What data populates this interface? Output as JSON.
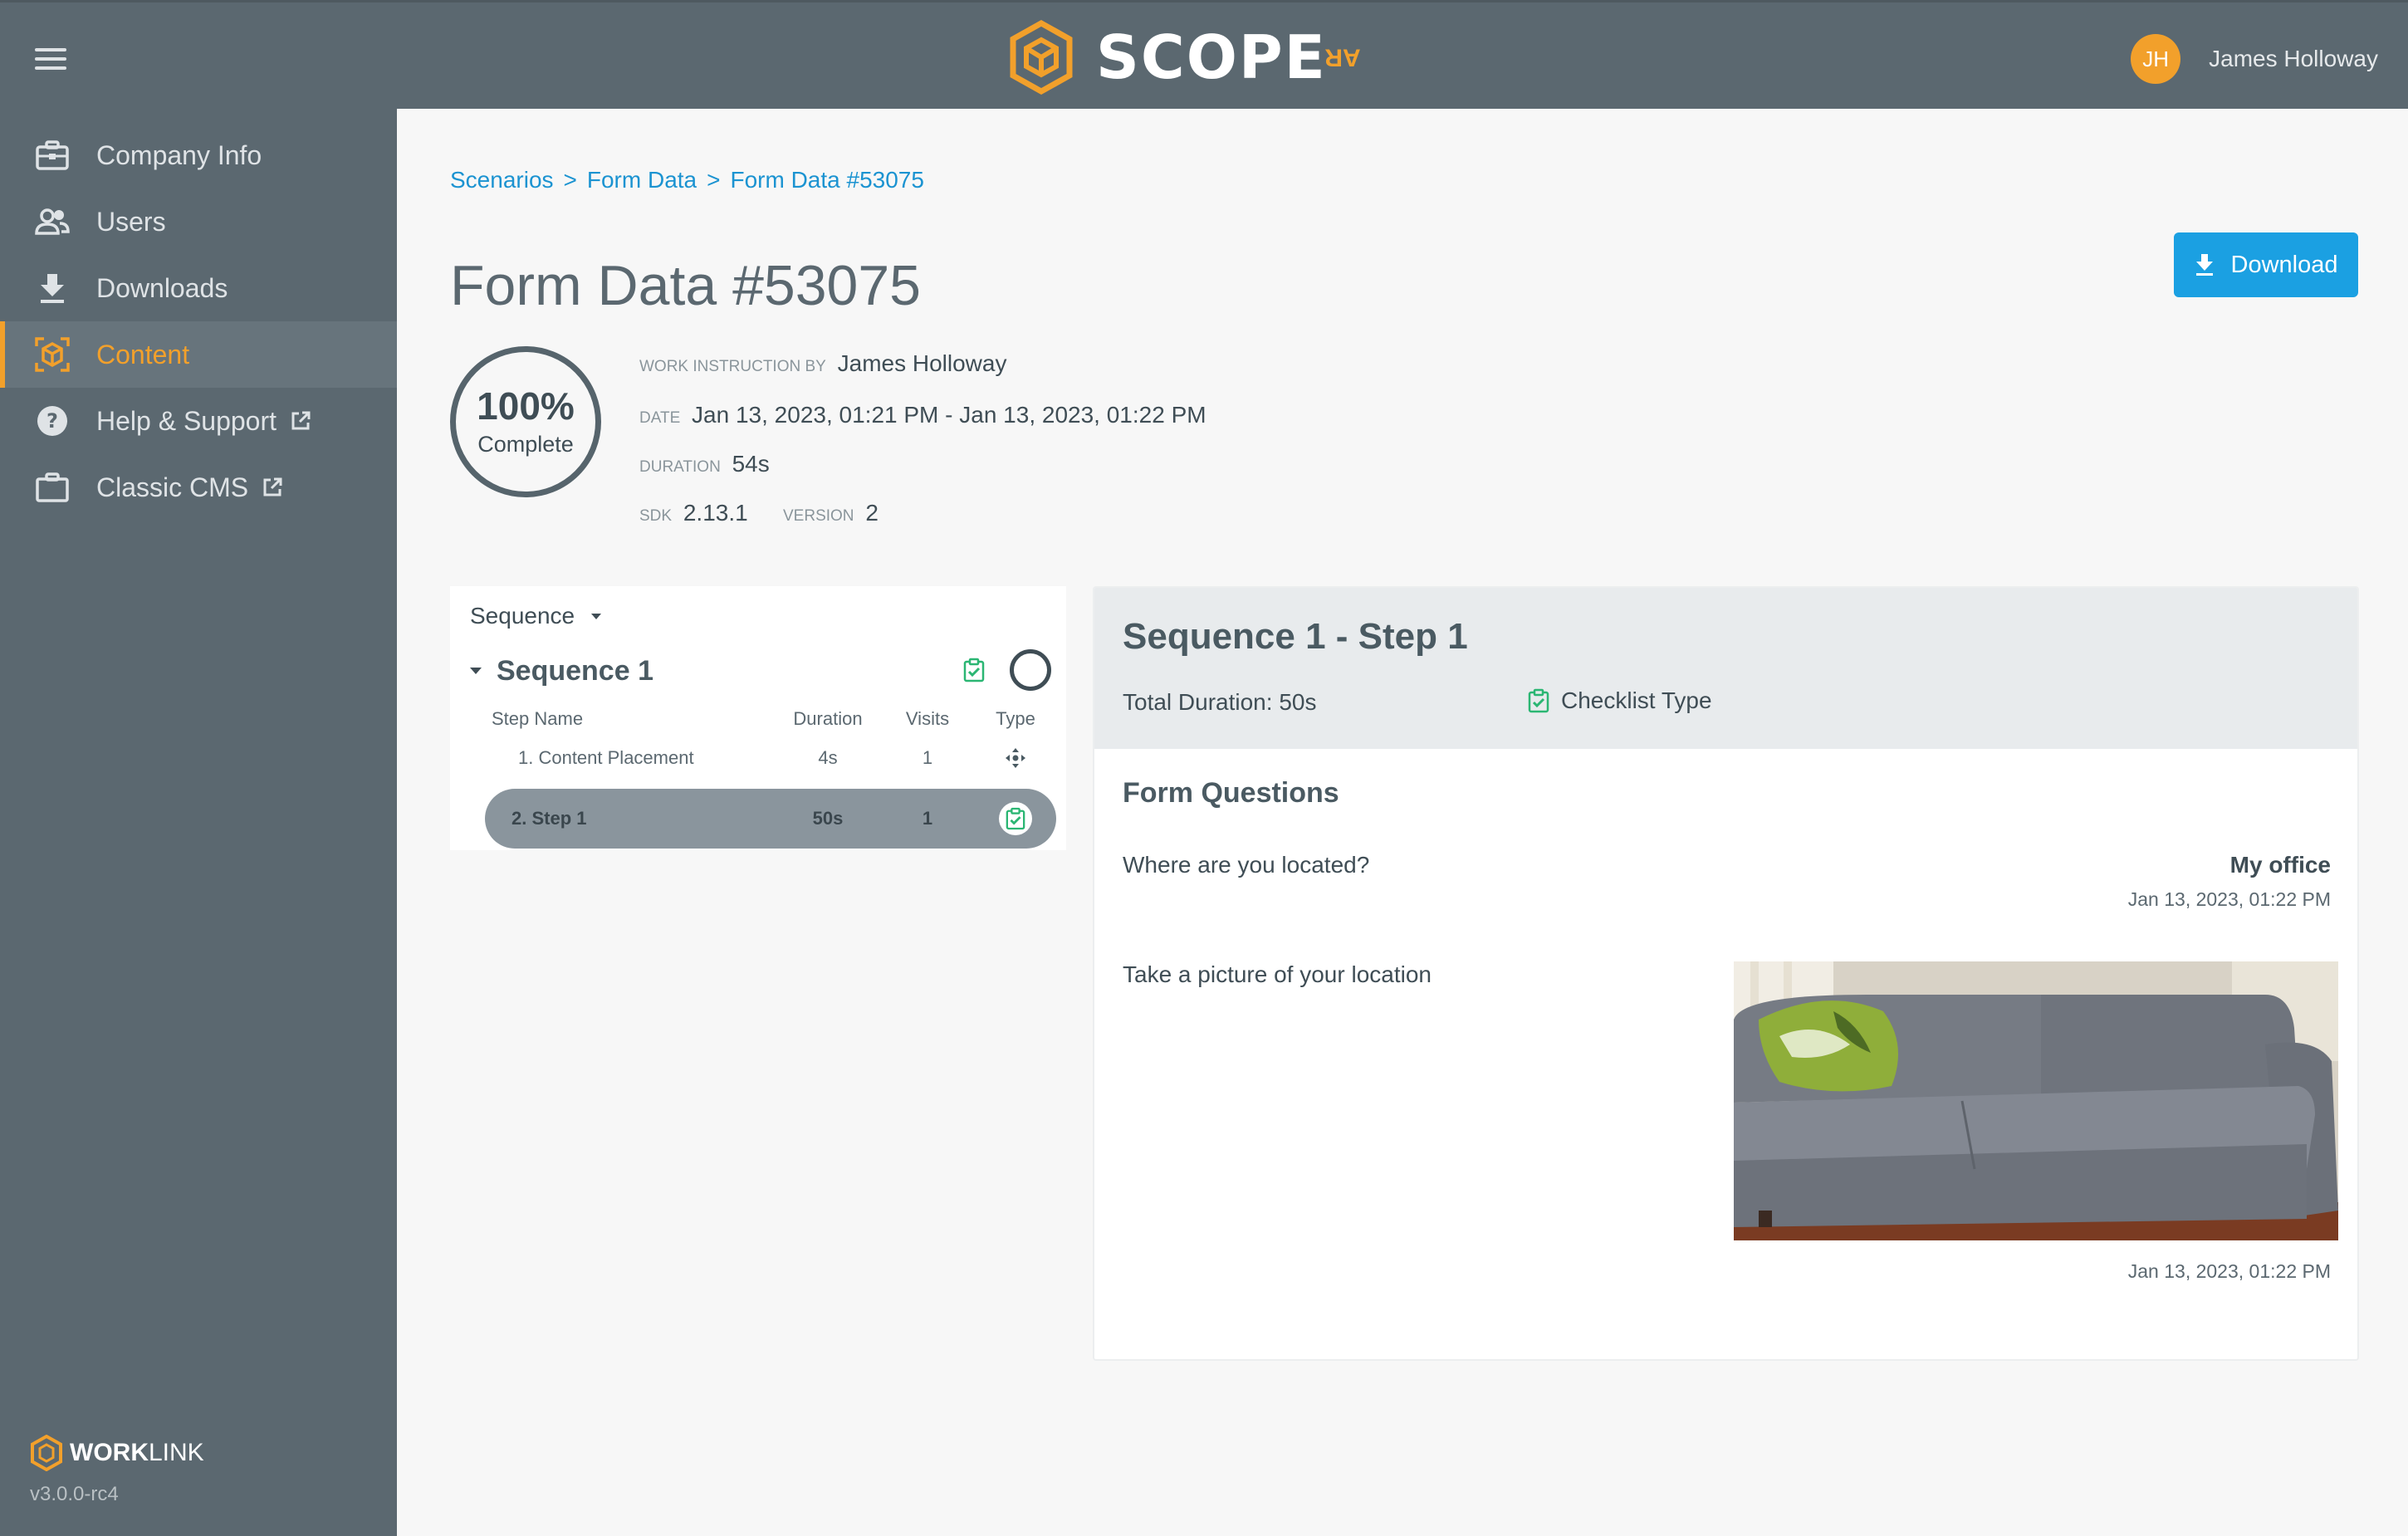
{
  "header": {
    "logo_text": "SCOPE",
    "logo_suffix": "AR",
    "user_initials": "JH",
    "user_name": "James Holloway"
  },
  "sidebar": {
    "items": [
      {
        "label": "Company Info",
        "icon": "briefcase-icon",
        "active": false,
        "external": false
      },
      {
        "label": "Users",
        "icon": "users-icon",
        "active": false,
        "external": false
      },
      {
        "label": "Downloads",
        "icon": "download-icon",
        "active": false,
        "external": false
      },
      {
        "label": "Content",
        "icon": "cube-icon",
        "active": true,
        "external": false
      },
      {
        "label": "Help & Support",
        "icon": "question-icon",
        "active": false,
        "external": true
      },
      {
        "label": "Classic CMS",
        "icon": "folder-icon",
        "active": false,
        "external": true
      }
    ],
    "brand_bold": "WORK",
    "brand_rest": "LINK",
    "version": "v3.0.0-rc4"
  },
  "breadcrumb": [
    "Scenarios",
    "Form Data",
    "Form Data #53075"
  ],
  "page_title": "Form Data #53075",
  "download_label": "Download",
  "progress": {
    "percent_text": "100%",
    "label": "Complete",
    "value": 1.0
  },
  "meta": {
    "instruction_key": "WORK INSTRUCTION BY",
    "instruction_val": "James Holloway",
    "date_key": "DATE",
    "date_val": "Jan 13, 2023, 01:21 PM - Jan 13, 2023, 01:22 PM",
    "duration_key": "DURATION",
    "duration_val": "54s",
    "sdk_key": "SDK",
    "sdk_val": "2.13.1",
    "version_key": "VERSION",
    "version_val": "2"
  },
  "sequence_panel": {
    "dropdown_label": "Sequence",
    "sequence_title": "Sequence 1",
    "columns": [
      "Step Name",
      "Duration",
      "Visits",
      "Type"
    ],
    "rows": [
      {
        "name": "1. Content Placement",
        "duration": "4s",
        "visits": "1",
        "type_icon": "move-icon"
      },
      {
        "name": "2. Step 1",
        "duration": "50s",
        "visits": "1",
        "type_icon": "checklist-icon"
      }
    ]
  },
  "detail": {
    "title": "Sequence 1 - Step 1",
    "total_duration": "Total Duration: 50s",
    "type_label": "Checklist Type",
    "questions_title": "Form Questions",
    "q1": "Where are you located?",
    "a1": "My office",
    "t1": "Jan 13, 2023, 01:22 PM",
    "q2": "Take a picture of your location",
    "t2": "Jan 13, 2023, 01:22 PM"
  },
  "colors": {
    "accent": "#f2a02b",
    "link": "#1b93d1",
    "button": "#1ba0e2",
    "sidebar": "#5b6870",
    "check": "#2bb673"
  }
}
